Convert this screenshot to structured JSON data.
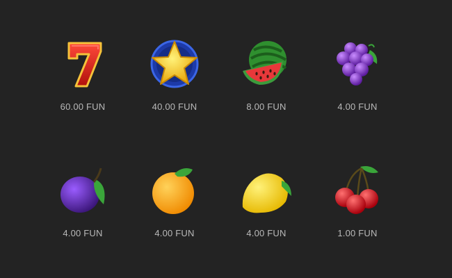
{
  "paytable": {
    "symbols": [
      {
        "icon": "seven-icon",
        "payout": "60.00 FUN"
      },
      {
        "icon": "star-icon",
        "payout": "40.00 FUN"
      },
      {
        "icon": "watermelon-icon",
        "payout": "8.00 FUN"
      },
      {
        "icon": "grapes-icon",
        "payout": "4.00 FUN"
      },
      {
        "icon": "plum-icon",
        "payout": "4.00 FUN"
      },
      {
        "icon": "orange-icon",
        "payout": "4.00 FUN"
      },
      {
        "icon": "lemon-icon",
        "payout": "4.00 FUN"
      },
      {
        "icon": "cherries-icon",
        "payout": "1.00 FUN"
      }
    ]
  },
  "colors": {
    "background": "#232323",
    "payout_text": "#b9b9b9"
  }
}
